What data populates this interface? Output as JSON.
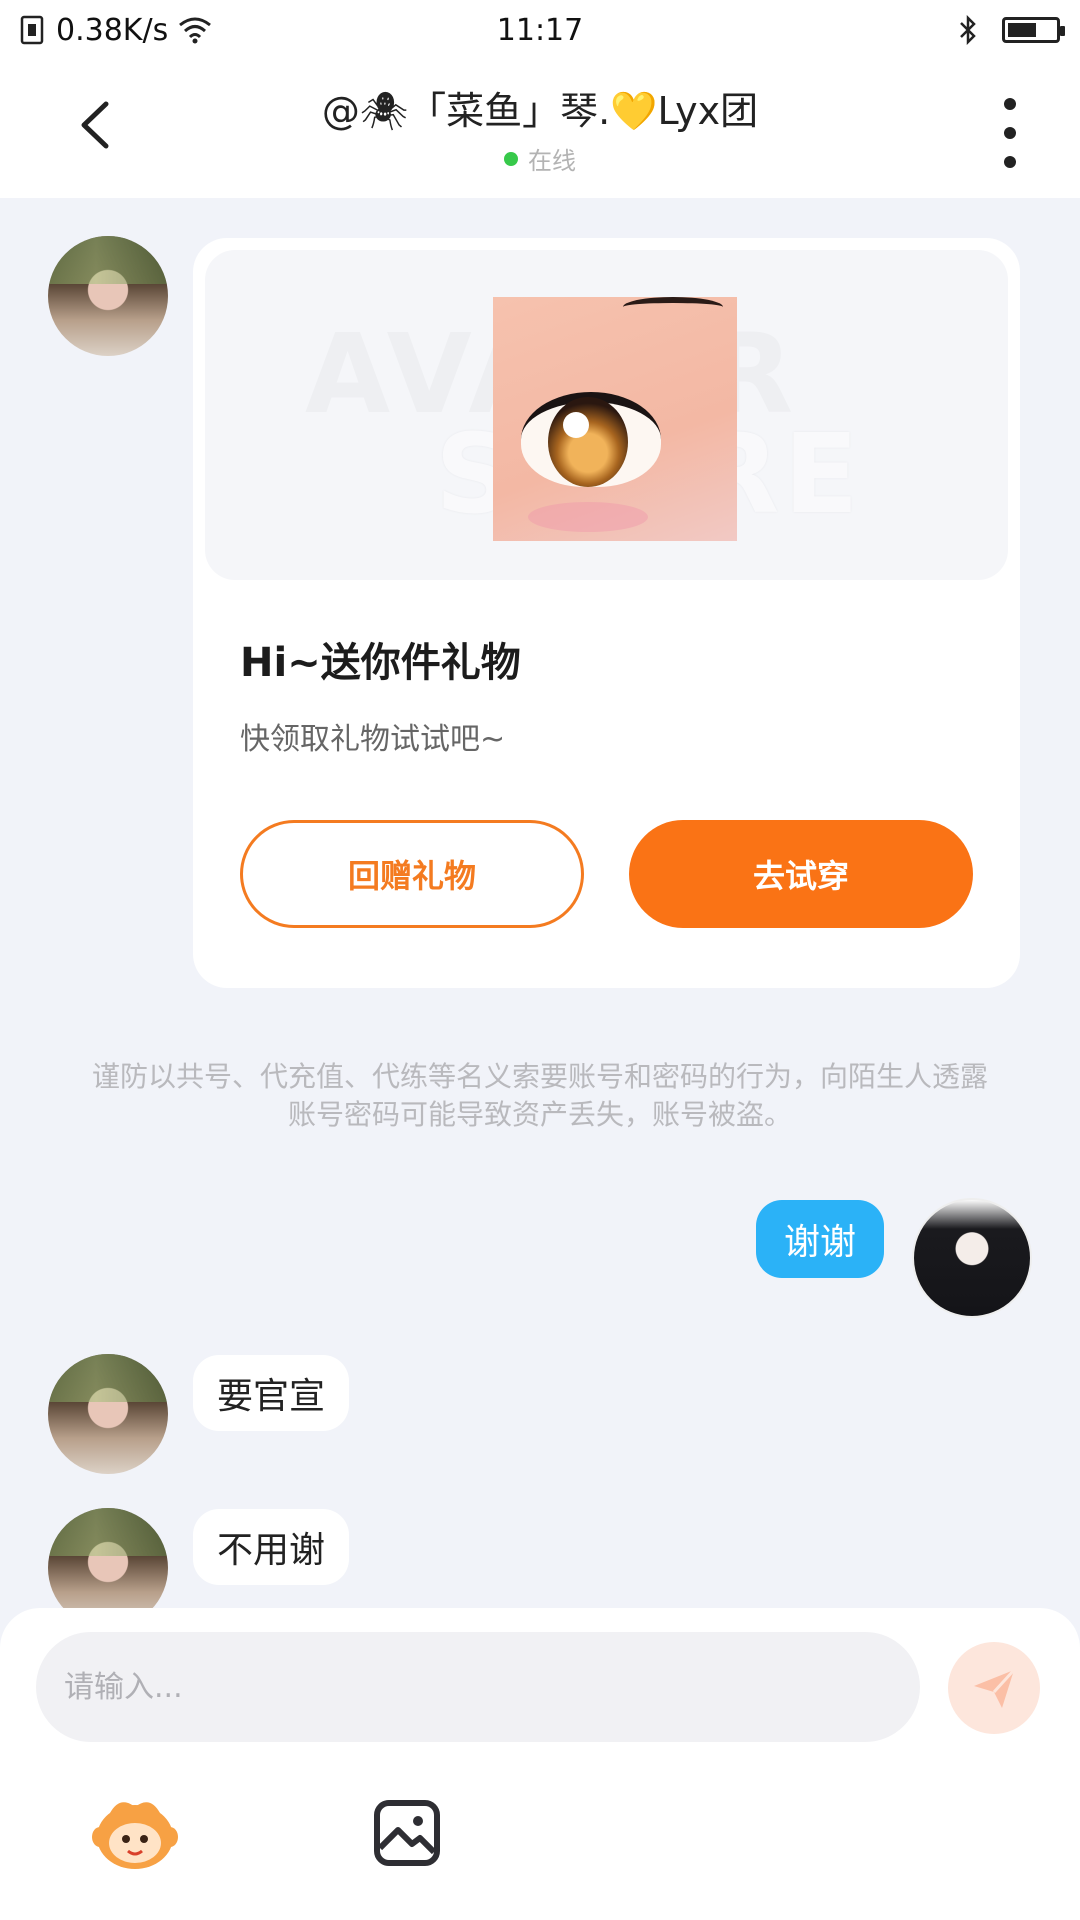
{
  "status_bar": {
    "network_speed": "0.38K/s",
    "time": "11:17",
    "icons": [
      "sim-icon",
      "wifi-icon",
      "bluetooth-icon",
      "battery-icon"
    ]
  },
  "header": {
    "back_icon": "chevron-left-icon",
    "title": "@🕷「菜鱼」琴.💛Lyx团",
    "online_status": "在线",
    "online_color": "#37c94a",
    "more_icon": "more-vertical-icon"
  },
  "gift_card": {
    "watermark_line1": "AVATAR",
    "watermark_line2": "STORE",
    "title": "Hi~送你件礼物",
    "subtitle": "快领取礼物试试吧~",
    "return_gift_label": "回赠礼物",
    "try_on_label": "去试穿",
    "accent_color": "#fa7315"
  },
  "warning_text": "谨防以共号、代充值、代练等名义索要账号和密码的行为，向陌生人透露账号密码可能导致资产丢失，账号被盗。",
  "messages": [
    {
      "from": "me",
      "text": "谢谢"
    },
    {
      "from": "other",
      "text": "要官宣"
    },
    {
      "from": "other",
      "text": "不用谢"
    }
  ],
  "input": {
    "placeholder": "请输入...",
    "value": "",
    "send_icon": "paper-plane-icon"
  },
  "toolbar": {
    "items": [
      "mascot-icon",
      "image-icon"
    ]
  }
}
